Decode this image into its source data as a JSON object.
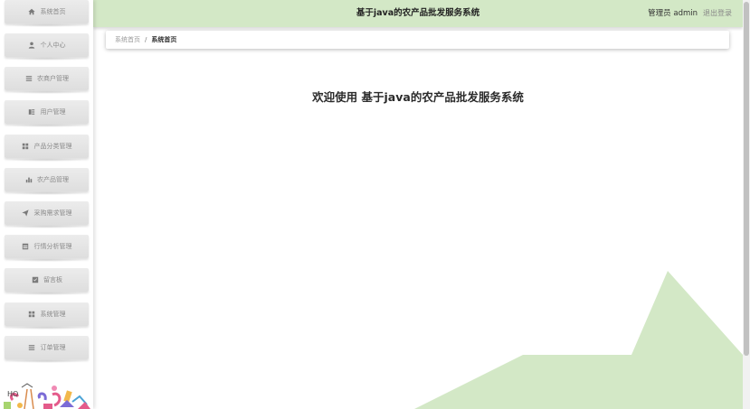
{
  "app": {
    "title": "基于java的农产品批发服务系统"
  },
  "header": {
    "title": "基于java的农产品批发服务系统",
    "user_label": "管理员 admin",
    "logout_label": "退出登录",
    "background": "#d3e8c6"
  },
  "sidebar": {
    "items": [
      {
        "label": "系统首页",
        "icon": "home-icon"
      },
      {
        "label": "个人中心",
        "icon": "user-icon"
      },
      {
        "label": "农商户管理",
        "icon": "list-icon"
      },
      {
        "label": "用户管理",
        "icon": "id-card-icon"
      },
      {
        "label": "产品分类管理",
        "icon": "grid-icon"
      },
      {
        "label": "农产品管理",
        "icon": "bar-chart-icon"
      },
      {
        "label": "采购需求管理",
        "icon": "send-icon"
      },
      {
        "label": "行情分析管理",
        "icon": "table-icon"
      },
      {
        "label": "留言板",
        "icon": "board-icon"
      },
      {
        "label": "系统管理",
        "icon": "grid-icon"
      },
      {
        "label": "订单管理",
        "icon": "list-icon"
      }
    ]
  },
  "breadcrumb": {
    "home": "系统首页",
    "separator": "/",
    "current": "系统首页"
  },
  "main": {
    "welcome": "欢迎使用 基于java的农产品批发服务系统"
  },
  "colors": {
    "accent": "#d3e8c6",
    "menu_text": "#8a8a8a"
  }
}
